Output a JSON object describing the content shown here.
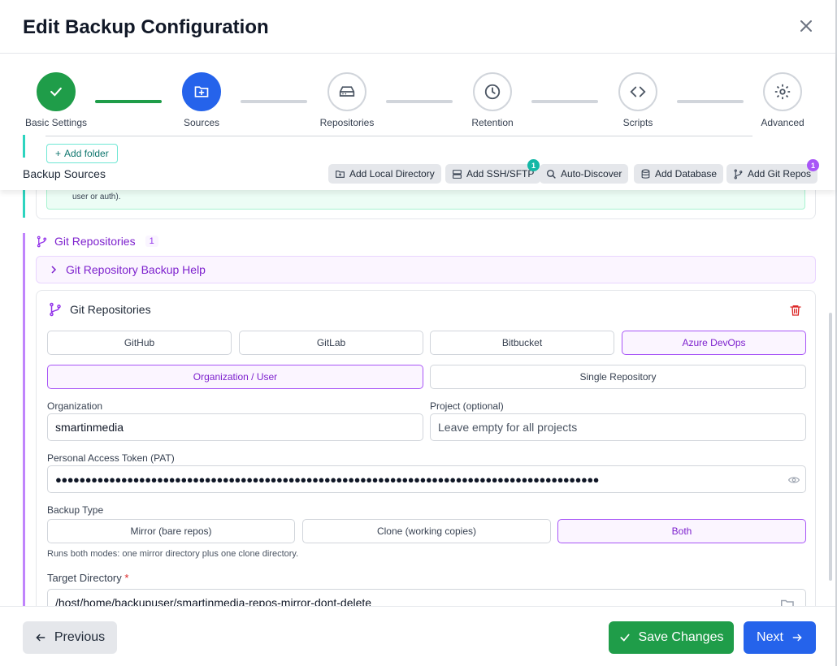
{
  "dialog": {
    "title": "Edit Backup Configuration"
  },
  "stepper": {
    "steps": [
      {
        "label": "Basic Settings",
        "state": "done",
        "icon": "check-icon"
      },
      {
        "label": "Sources",
        "state": "active",
        "icon": "folder-plus-icon"
      },
      {
        "label": "Repositories",
        "state": "pending",
        "icon": "hard-drive-icon"
      },
      {
        "label": "Retention",
        "state": "pending",
        "icon": "clock-icon"
      },
      {
        "label": "Scripts",
        "state": "pending",
        "icon": "code-icon"
      },
      {
        "label": "Advanced",
        "state": "pending",
        "icon": "gear-icon"
      }
    ]
  },
  "sources": {
    "label": "Backup Sources",
    "add_folder_label": "Add folder",
    "buttons": [
      {
        "label": "Add Local Directory",
        "icon": "folder-plus-icon"
      },
      {
        "label": "Add SSH/SFTP",
        "icon": "server-icon",
        "badge": "1"
      },
      {
        "label": "Auto-Discover",
        "icon": "search-icon"
      },
      {
        "label": "Add Database",
        "icon": "database-icon"
      },
      {
        "label": "Add Git Repos",
        "icon": "git-branch-icon",
        "badge": "1"
      }
    ],
    "info_tail": "user or auth)."
  },
  "git": {
    "section_label": "Git Repositories",
    "count": "1",
    "help_label": "Git Repository Backup Help",
    "card_title": "Git Repositories",
    "providers": [
      "GitHub",
      "GitLab",
      "Bitbucket",
      "Azure DevOps"
    ],
    "selected_provider": "Azure DevOps",
    "scopes": [
      "Organization / User",
      "Single Repository"
    ],
    "selected_scope": "Organization / User",
    "organization": {
      "label": "Organization",
      "value": "smartinmedia"
    },
    "project": {
      "label": "Project (optional)",
      "placeholder": "Leave empty for all projects"
    },
    "pat": {
      "label": "Personal Access Token (PAT)",
      "masked_value": "●●●●●●●●●●●●●●●●●●●●●●●●●●●●●●●●●●●●●●●●●●●●●●●●●●●●●●●●●●●●●●●●●●●●●●●●●●●●●●●●●●●●●●●●●●●"
    },
    "backup_type": {
      "label": "Backup Type",
      "options": [
        "Mirror (bare repos)",
        "Clone (working copies)",
        "Both"
      ],
      "selected": "Both",
      "hint": "Runs both modes: one mirror directory plus one clone directory."
    },
    "target": {
      "label": "Target Directory",
      "required": "*",
      "value": "/host/home/backupuser/smartinmedia-repos-mirror-dont-delete"
    }
  },
  "footer": {
    "previous_label": "Previous",
    "save_label": "Save Changes",
    "next_label": "Next"
  },
  "colors": {
    "green": "#1f9d49",
    "blue": "#2563eb",
    "purple": "#7e22ce",
    "teal": "#2dd4bf"
  }
}
